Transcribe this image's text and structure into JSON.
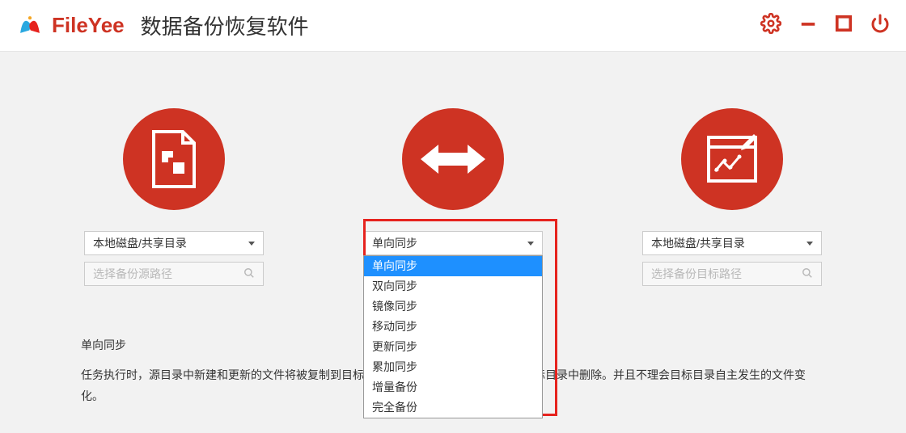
{
  "brand": "FileYee",
  "app_title": "数据备份恢复软件",
  "left": {
    "select": "本地磁盘/共享目录",
    "placeholder": "选择备份源路径"
  },
  "center": {
    "select": "单向同步",
    "options": [
      "单向同步",
      "双向同步",
      "镜像同步",
      "移动同步",
      "更新同步",
      "累加同步",
      "增量备份",
      "完全备份"
    ]
  },
  "right": {
    "select": "本地磁盘/共享目录",
    "placeholder": "选择备份目标路径"
  },
  "description": {
    "title": "单向同步",
    "body": "任务执行时，源目录中新建和更新的文件将被复制到目标目录，源目录中删除的文件将在目标目录中删除。并且不理会目标目录自主发生的文件变化。"
  }
}
